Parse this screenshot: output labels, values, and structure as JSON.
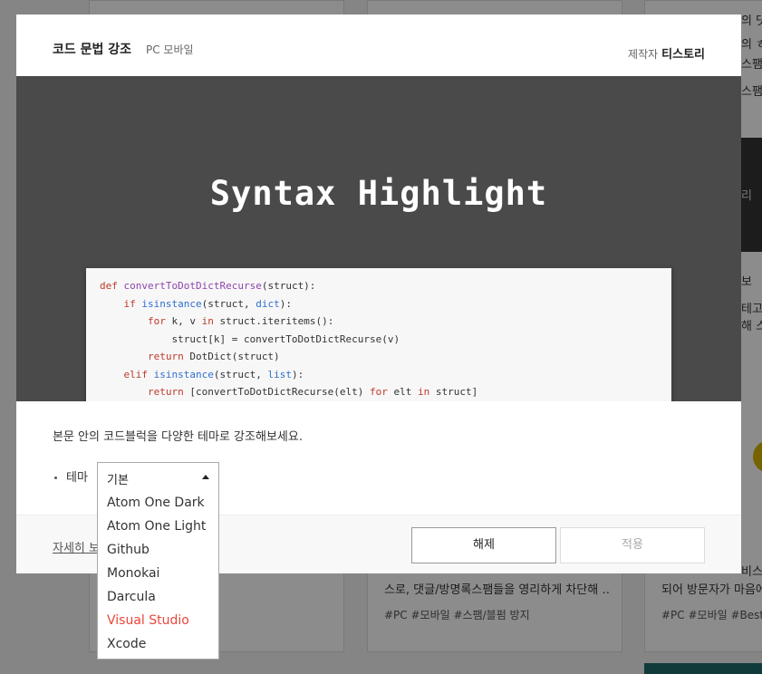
{
  "background": {
    "card_texts": [
      "스로, 댓글/방명록스팸들을 영리하게 차단해 …",
      "되어 방문자가 마음에"
    ],
    "card_tags": [
      "#PC  #모바일  #스팸/블펌 방지",
      "#PC  #모바일  #Best"
    ],
    "right_snippets": [
      "의 댓글/방명록",
      "의 ㅎ",
      "스팸",
      "스팸/",
      "리",
      "보",
      "테고",
      "해 스",
      "비스"
    ]
  },
  "modal": {
    "title": "코드 문법 강조",
    "platform": "PC 모바일",
    "maker_label": "제작자",
    "maker_name": "티스토리",
    "preview": {
      "title": "Syntax Highlight",
      "code_lines": [
        [
          {
            "t": "def ",
            "c": "kw2"
          },
          {
            "t": "convertToDotDictRecurse",
            "c": "fn"
          },
          {
            "t": "(struct):",
            "c": ""
          }
        ],
        [
          {
            "t": "    ",
            "c": ""
          },
          {
            "t": "if ",
            "c": "kw2"
          },
          {
            "t": "isinstance",
            "c": "bi"
          },
          {
            "t": "(struct, ",
            "c": ""
          },
          {
            "t": "dict",
            "c": "bi"
          },
          {
            "t": "):",
            "c": ""
          }
        ],
        [
          {
            "t": "        ",
            "c": ""
          },
          {
            "t": "for ",
            "c": "kw2"
          },
          {
            "t": "k, v ",
            "c": ""
          },
          {
            "t": "in ",
            "c": "kw2"
          },
          {
            "t": "struct.iteritems():",
            "c": ""
          }
        ],
        [
          {
            "t": "            struct[k] = convertToDotDictRecurse(v)",
            "c": ""
          }
        ],
        [
          {
            "t": "        ",
            "c": ""
          },
          {
            "t": "return ",
            "c": "kw2"
          },
          {
            "t": "DotDict(struct)",
            "c": ""
          }
        ],
        [
          {
            "t": "    ",
            "c": ""
          },
          {
            "t": "elif ",
            "c": "kw2"
          },
          {
            "t": "isinstance",
            "c": "bi"
          },
          {
            "t": "(struct, ",
            "c": ""
          },
          {
            "t": "list",
            "c": "bi"
          },
          {
            "t": "):",
            "c": ""
          }
        ],
        [
          {
            "t": "        ",
            "c": ""
          },
          {
            "t": "return ",
            "c": "kw2"
          },
          {
            "t": "[convertToDotDictRecurse(elt) ",
            "c": ""
          },
          {
            "t": "for ",
            "c": "kw2"
          },
          {
            "t": "elt ",
            "c": ""
          },
          {
            "t": "in ",
            "c": "kw2"
          },
          {
            "t": "struct]",
            "c": ""
          }
        ]
      ]
    },
    "description": "본문 안의 코드블럭을 다양한 테마로 강조해보세요.",
    "theme_label": "테마",
    "theme_select": {
      "value": "기본",
      "options": [
        "Atom One Dark",
        "Atom One Light",
        "Github",
        "Monokai",
        "Darcula",
        "Visual Studio",
        "Xcode"
      ],
      "highlighted": "Visual Studio"
    },
    "footer": {
      "detail_link": "자세히 보기",
      "release_button": "해제",
      "apply_button": "적용"
    }
  },
  "colors": {
    "highlight_option": "#e8463a",
    "preview_bg": "#4a4a4a"
  }
}
